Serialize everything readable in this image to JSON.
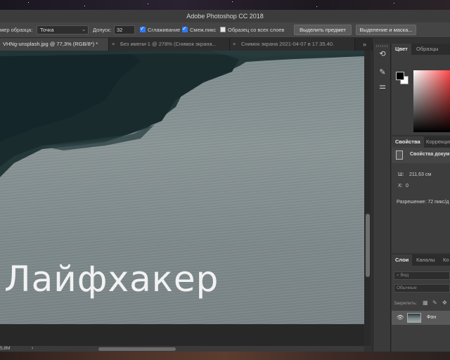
{
  "window": {
    "title": "Adobe Photoshop CC 2018"
  },
  "options_bar": {
    "sample_size_label": "мер образца:",
    "sample_size_value": "Точка",
    "tolerance_label": "Допуск:",
    "tolerance_value": "32",
    "antialias_label": "Сглаживание",
    "antialias_checked": true,
    "contiguous_label": "Смеж.пикс",
    "contiguous_checked": true,
    "all_layers_label": "Образец со всех слоев",
    "all_layers_checked": false,
    "select_subject_label": "Выделить предмет",
    "select_mask_label": "Выделение и маска..."
  },
  "tabs": [
    {
      "label": "VHNg-unsplash.jpg @ 77,3% (RGB/8*) *",
      "active": true
    },
    {
      "label": "Без имени-1 @ 278% (Снимок экрана...",
      "active": false
    },
    {
      "label": "Снимок экрана 2021-04-07 в 17.35.40.",
      "active": false
    }
  ],
  "tabs_overflow": "»",
  "canvas": {
    "watermark_text": "Лайфхакер"
  },
  "status": {
    "doc_size": "5,8M",
    "arrow": "›"
  },
  "color_panel": {
    "tabs": [
      "Цвет",
      "Образцы"
    ],
    "foreground_color": "#000000",
    "background_color": "#ffffff"
  },
  "properties_panel": {
    "tabs": [
      "Свойства",
      "Коррекция"
    ],
    "title": "Свойства докум",
    "width_label": "Ш:",
    "width_value": "211,63 см",
    "x_label": "X:",
    "x_value": "0",
    "resolution": "Разрешение: 72 пикс/д"
  },
  "layers_panel": {
    "tabs": [
      "Слои",
      "Каналы",
      "Ко"
    ],
    "search_placeholder": "Вид",
    "blend_mode": "Обычные",
    "lock_label": "Закрепить:",
    "layers": [
      {
        "name": "Фон",
        "visible": true
      }
    ]
  }
}
